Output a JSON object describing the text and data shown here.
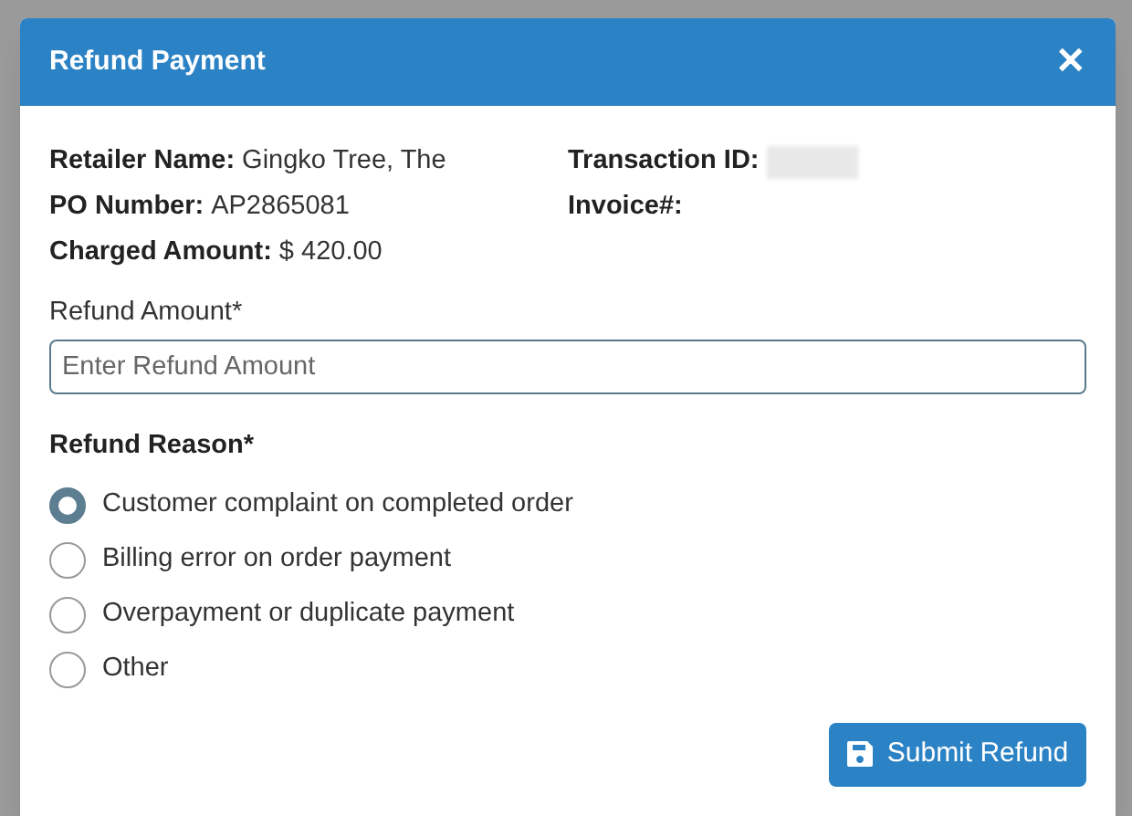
{
  "dialog": {
    "title": "Refund Payment",
    "close": "✕"
  },
  "details_left": [
    {
      "label": "Retailer Name:",
      "value": "Gingko Tree, The"
    },
    {
      "label": "PO Number:",
      "value": "AP2865081"
    },
    {
      "label": "Charged Amount:",
      "value": "$ 420.00"
    }
  ],
  "details_right": [
    {
      "label": "Transaction ID:",
      "kind": "redacted"
    },
    {
      "label": "Invoice#:",
      "kind": "empty"
    }
  ],
  "refund_amount": {
    "label": "Refund Amount*",
    "placeholder": "Enter Refund Amount"
  },
  "refund_reason": {
    "label": "Refund Reason*",
    "options": [
      {
        "label": "Customer complaint on completed order",
        "selected": true
      },
      {
        "label": "Billing error on order payment",
        "selected": false
      },
      {
        "label": "Overpayment or duplicate payment",
        "selected": false
      },
      {
        "label": "Other",
        "selected": false
      }
    ]
  },
  "submit": {
    "label": "Submit Refund"
  }
}
